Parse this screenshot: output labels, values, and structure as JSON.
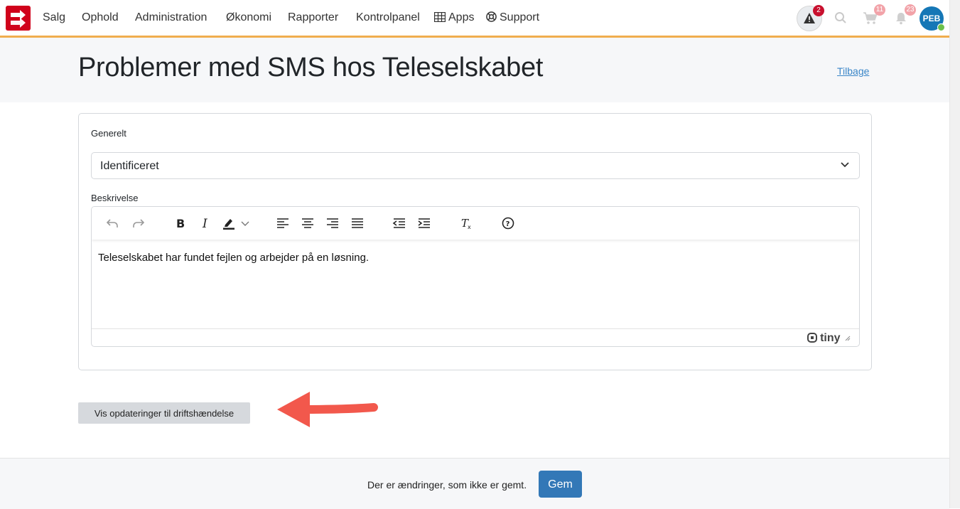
{
  "nav": {
    "items": [
      {
        "label": "Salg"
      },
      {
        "label": "Ophold"
      },
      {
        "label": "Administration"
      },
      {
        "label": "Økonomi"
      },
      {
        "label": "Rapporter"
      },
      {
        "label": "Kontrolpanel"
      },
      {
        "label": "Apps",
        "icon": "grid-icon"
      },
      {
        "label": "Support",
        "icon": "lifebuoy-icon"
      }
    ],
    "alerts_count": "2",
    "cart_count": "11",
    "notifications_count": "23",
    "user_initials": "PEB",
    "accent_color": "#f0ad4e",
    "logo_color": "#d0021b"
  },
  "header": {
    "title": "Problemer med SMS hos Teleselskabet",
    "back_label": "Tilbage"
  },
  "form": {
    "general_label": "Generelt",
    "status_value": "Identificeret",
    "description_label": "Beskrivelse",
    "description_text": "Teleselskabet har fundet fejlen og arbejder på en løsning.",
    "editor_brand": "tiny"
  },
  "actions": {
    "show_updates_label": "Vis opdateringer til driftshændelse"
  },
  "footer": {
    "unsaved_text": "Der er ændringer, som ikke er gemt.",
    "save_label": "Gem",
    "save_color": "#3378b7"
  }
}
